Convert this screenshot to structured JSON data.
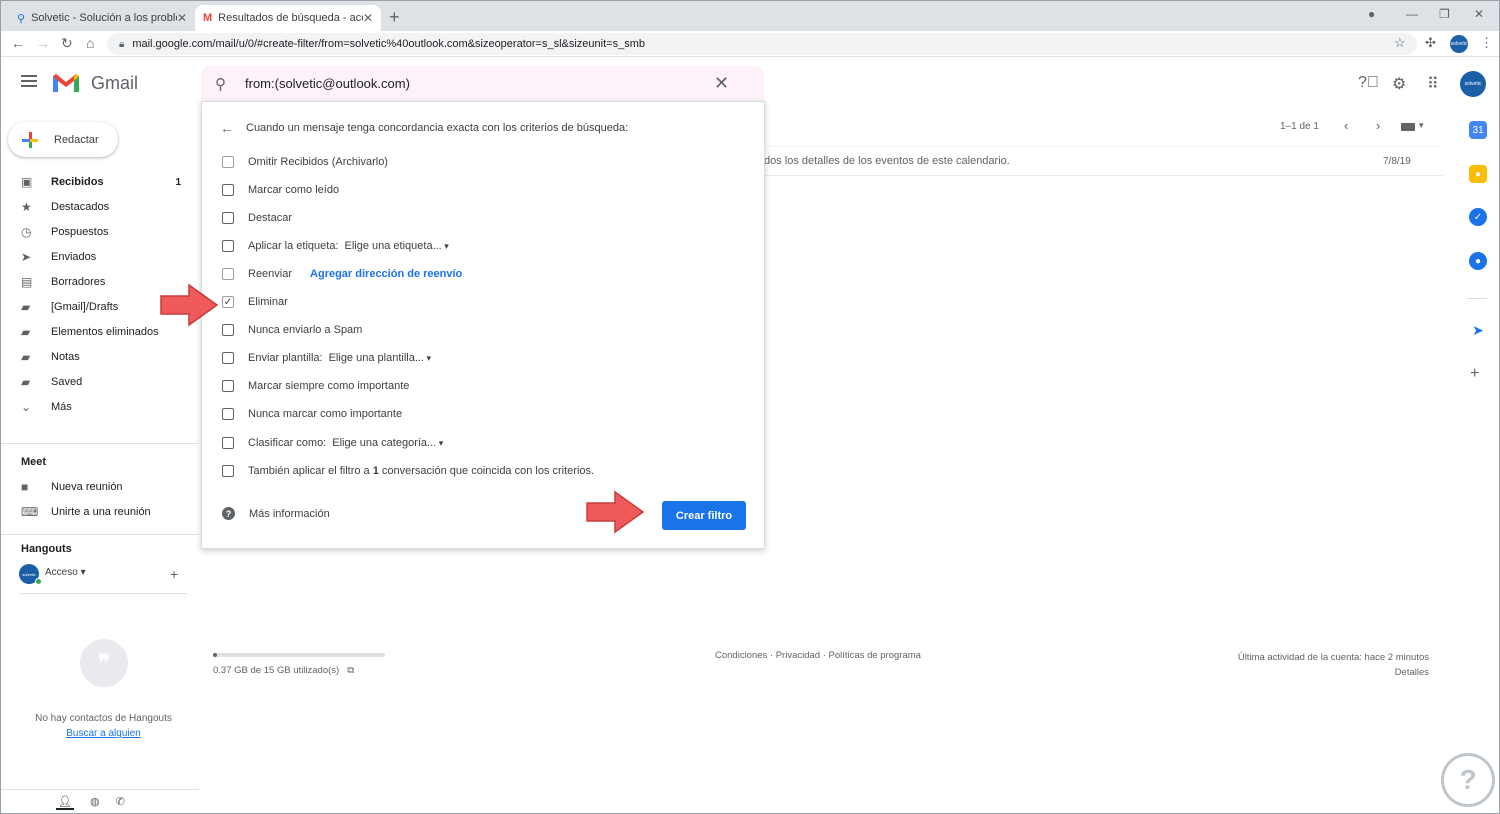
{
  "browser": {
    "tabs": [
      {
        "title": "Solvetic - Solución a los problem",
        "icon": "solvetic-icon"
      },
      {
        "title": "Resultados de búsqueda - acces",
        "icon": "gmail-icon"
      }
    ],
    "url": "mail.google.com/mail/u/0/#create-filter/from=solvetic%40outlook.com&sizeoperator=s_sl&sizeunit=s_smb",
    "profile_label": "solvetic"
  },
  "gmail": {
    "app_name": "Gmail",
    "compose_label": "Redactar",
    "account_label": "solvetic"
  },
  "search": {
    "query": "from:(solvetic@outlook.com)"
  },
  "filter_dialog": {
    "heading": "Cuando un mensaje tenga concordancia exacta con los criterios de búsqueda:",
    "options": [
      {
        "label": "Omitir Recibidos (Archivarlo)",
        "checked": false
      },
      {
        "label": "Marcar como leído",
        "checked": false
      },
      {
        "label": "Destacar",
        "checked": false
      },
      {
        "label": "Aplicar la etiqueta:",
        "checked": false,
        "dropdown": "Elige una etiqueta..."
      },
      {
        "label": "Reenviar",
        "checked": false,
        "link": "Agregar dirección de reenvío"
      },
      {
        "label": "Eliminar",
        "checked": true
      },
      {
        "label": "Nunca enviarlo a Spam",
        "checked": false
      },
      {
        "label": "Enviar plantilla:",
        "checked": false,
        "dropdown": "Elige una plantilla..."
      },
      {
        "label": "Marcar siempre como importante",
        "checked": false
      },
      {
        "label": "Nunca marcar como importante",
        "checked": false
      },
      {
        "label": "Clasificar como:",
        "checked": false,
        "dropdown": "Elige una categoría..."
      },
      {
        "label_pre": "También aplicar el filtro a ",
        "label_bold": "1",
        "label_post": " conversación que coincida con los criterios.",
        "checked": false
      }
    ],
    "more_info": "Más información",
    "create_button": "Crear filtro"
  },
  "sidebar": {
    "items": [
      {
        "label": "Recibidos",
        "icon": "inbox-icon",
        "count": "1",
        "bold": true
      },
      {
        "label": "Destacados",
        "icon": "star-icon"
      },
      {
        "label": "Pospuestos",
        "icon": "clock-icon"
      },
      {
        "label": "Enviados",
        "icon": "send-icon"
      },
      {
        "label": "Borradores",
        "icon": "draft-icon"
      },
      {
        "label": "[Gmail]/Drafts",
        "icon": "label-icon"
      },
      {
        "label": "Elementos eliminados",
        "icon": "label-icon"
      },
      {
        "label": "Notas",
        "icon": "label-icon"
      },
      {
        "label": "Saved",
        "icon": "label-icon"
      },
      {
        "label": "Más",
        "icon": "chevron-down-icon"
      }
    ],
    "meet": {
      "title": "Meet",
      "items": [
        {
          "label": "Nueva reunión",
          "icon": "video-icon"
        },
        {
          "label": "Unirte a una reunión",
          "icon": "keyboard-icon"
        }
      ]
    },
    "hangouts": {
      "title": "Hangouts",
      "user": "Acceso",
      "empty_text": "No hay contactos de Hangouts",
      "find_link": "Buscar a alguien"
    }
  },
  "mail_list": {
    "pager": "1–1 de 1",
    "rows": [
      {
        "snippet": "dos los detalles de los eventos de este calendario.",
        "date": "7/8/19"
      }
    ]
  },
  "footer": {
    "storage_text": "0.37 GB de 15 GB utilizado(s)",
    "storage_used_fraction": 0.025,
    "links": "Condiciones · Privacidad · Políticas de programa",
    "activity": "Última actividad de la cuenta: hace 2 minutos",
    "details": "Detalles"
  },
  "colors": {
    "accent": "#1a73e8",
    "arrow": "#f15a5a",
    "search_bg": "#fdf2f9"
  }
}
